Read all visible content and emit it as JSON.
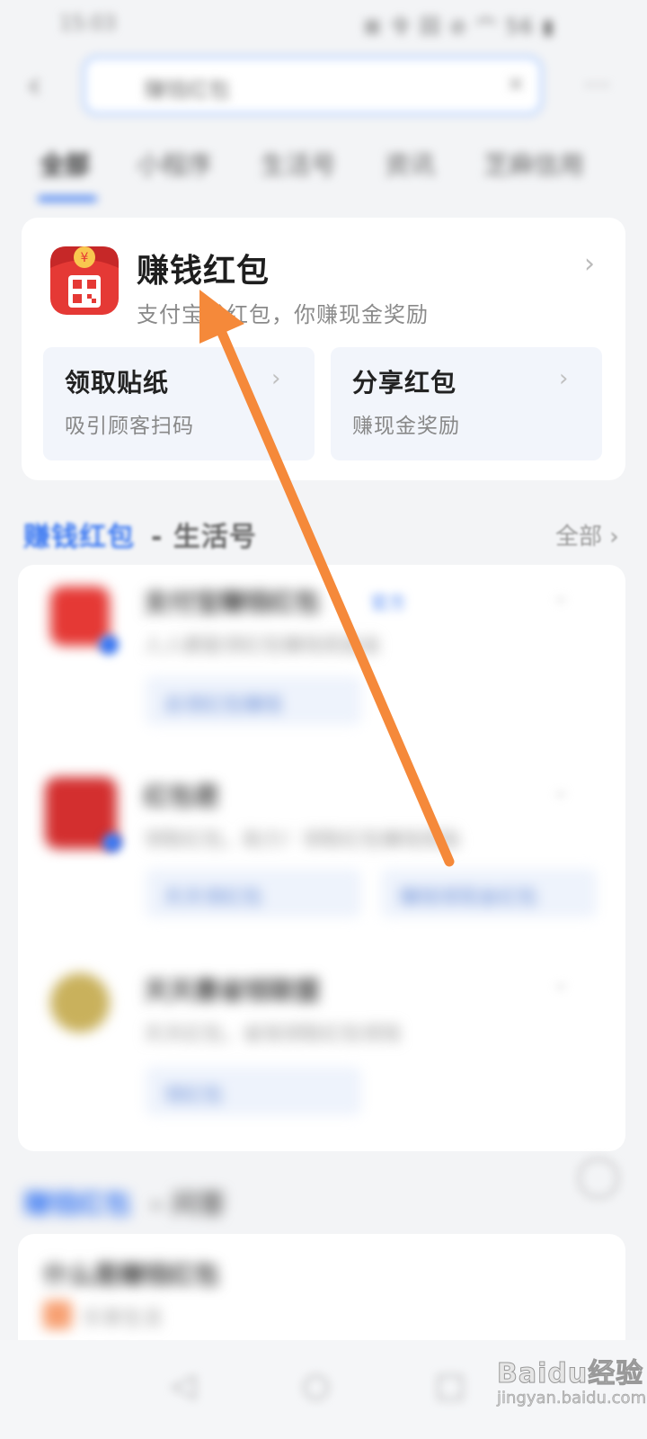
{
  "status": {
    "time": "15:03",
    "indicators": "⊠ 令 回 ⊘ 宀 56 ▮"
  },
  "search": {
    "query": "赚钱红包",
    "clear_icon": "close-icon",
    "back_icon": "chevron-left-icon",
    "more_icon": "more-icon"
  },
  "tabs": [
    {
      "label": "全部"
    },
    {
      "label": "小程序"
    },
    {
      "label": "生活号"
    },
    {
      "label": "资讯"
    },
    {
      "label": "芝麻信用"
    }
  ],
  "top_card": {
    "title": "赚钱红包",
    "subtitle": "支付宝发红包，你赚现金奖励",
    "sub_cards": [
      {
        "title": "领取贴纸",
        "desc": "吸引顾客扫码"
      },
      {
        "title": "分享红包",
        "desc": "赚现金奖励"
      }
    ]
  },
  "section_life": {
    "keyword": "赚钱红包",
    "separator": "- 生活号",
    "all_label": "全部"
  },
  "life_items": [
    {
      "title": "支付宝赚钱红包",
      "badge": "官方",
      "desc": "人人都能领红包赚钱奖励金",
      "buttons": [
        "去领红包赚钱"
      ]
    },
    {
      "title": "红包君",
      "desc": "领取红包，助力！领取红包赚钱奖励",
      "buttons": [
        "天天领红包",
        "赚钱领现金红包"
      ]
    },
    {
      "title": "天天惠省钱联盟",
      "desc": "天天红包，省钱领取红包领钱",
      "buttons": [
        "领红包"
      ]
    }
  ],
  "section_qa": {
    "keyword": "赚钱红包",
    "separator": "- 问答"
  },
  "qa_items": [
    {
      "title": "什么是赚钱红包",
      "desc": "乐享生活"
    }
  ],
  "nav": {
    "back": "◁",
    "home": "○",
    "recents": "□"
  },
  "watermark": {
    "brand": "Baidu经验",
    "url": "jingyan.baidu.com"
  },
  "colors": {
    "accent": "#3a78f2",
    "arrow": "#f5893a",
    "logo_red": "#e53935"
  }
}
